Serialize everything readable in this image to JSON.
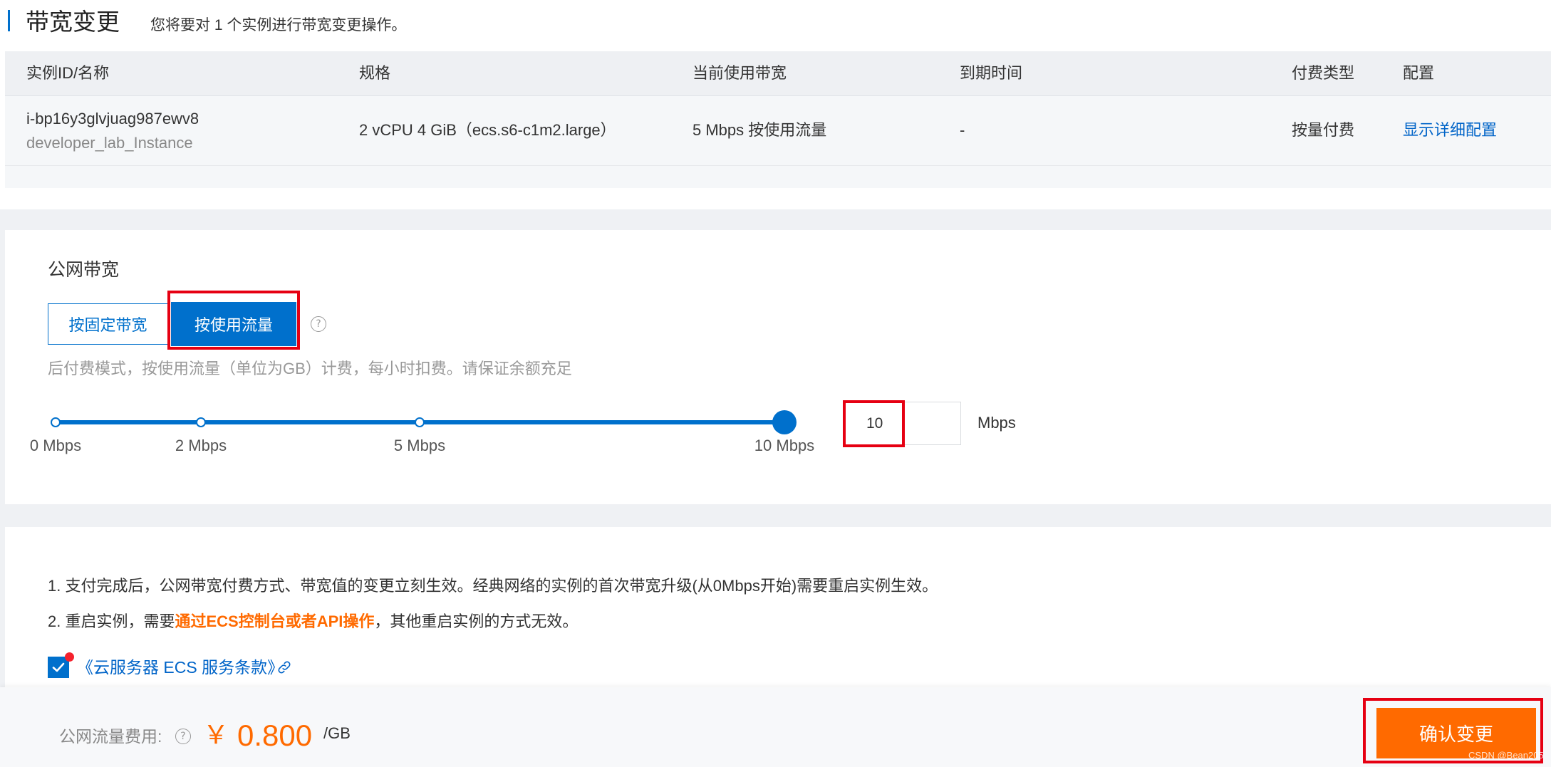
{
  "header": {
    "title": "带宽变更",
    "subtitle": "您将要对 1 个实例进行带宽变更操作。"
  },
  "table": {
    "columns": [
      "实例ID/名称",
      "规格",
      "当前使用带宽",
      "到期时间",
      "付费类型",
      "配置"
    ],
    "rows": [
      {
        "instance_id": "i-bp16y3glvjuag987ewv8",
        "instance_name": "developer_lab_Instance",
        "spec": "2 vCPU 4 GiB（ecs.s6-c1m2.large）",
        "bandwidth": "5 Mbps 按使用流量",
        "expire": "-",
        "billing": "按量付费",
        "config_link": "显示详细配置"
      }
    ]
  },
  "bandwidth": {
    "section_title": "公网带宽",
    "options": [
      {
        "label": "按固定带宽",
        "selected": false
      },
      {
        "label": "按使用流量",
        "selected": true
      }
    ],
    "description": "后付费模式，按使用流量（单位为GB）计费，每小时扣费。请保证余额充足",
    "slider": {
      "value": 10,
      "marks": [
        {
          "value": 0,
          "label": "0 Mbps"
        },
        {
          "value": 2,
          "label": "2 Mbps"
        },
        {
          "value": 5,
          "label": "5 Mbps"
        },
        {
          "value": 10,
          "label": "10 Mbps"
        }
      ]
    },
    "input_value": "10",
    "unit": "Mbps"
  },
  "notes": {
    "line1": "1. 支付完成后，公网带宽付费方式、带宽值的变更立刻生效。经典网络的实例的首次带宽升级(从0Mbps开始)需要重启实例生效。",
    "line2_prefix": "2. 重启实例，需要",
    "line2_highlight": "通过ECS控制台或者API操作",
    "line2_suffix": "，其他重启实例的方式无效。"
  },
  "agreement": {
    "checked": true,
    "label": "《云服务器 ECS 服务条款》"
  },
  "footer": {
    "fee_label": "公网流量费用:",
    "currency": "￥",
    "price": "0.800",
    "unit": "/GB",
    "confirm_label": "确认变更"
  },
  "watermark": "CSDN @Bean205",
  "icons": [
    "help-icon",
    "checkmark-icon",
    "link-icon"
  ],
  "colors": {
    "primary": "#0070cc",
    "accent": "#ff6a00",
    "annotation_red": "#e60012"
  }
}
